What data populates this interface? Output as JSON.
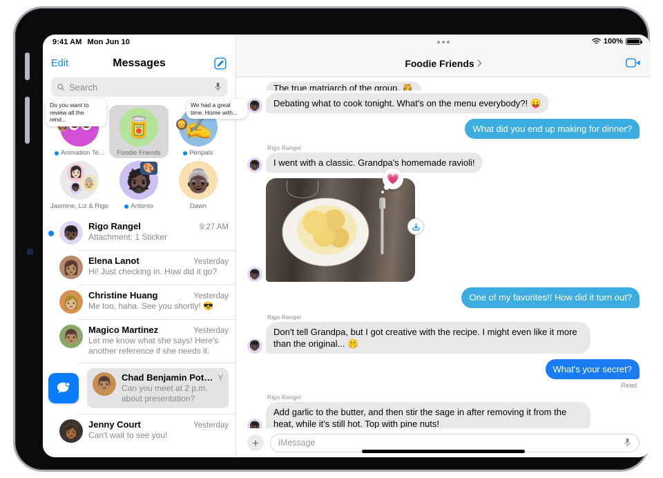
{
  "status_bar": {
    "time": "9:41 AM",
    "date": "Mon Jun 10",
    "battery_percent": "100%",
    "wifi_icon": "wifi-icon",
    "battery_icon": "battery-icon"
  },
  "sidebar": {
    "edit_label": "Edit",
    "title": "Messages",
    "compose_icon": "compose-icon",
    "search": {
      "placeholder": "Search",
      "search_icon": "search-icon",
      "mic_icon": "microphone-icon"
    },
    "pinned": [
      {
        "name": "Animation Te...",
        "full_name": "Animation Team",
        "avatar_emoji": "",
        "avatar_bg": "#d34fd6",
        "unread": true,
        "selected": false,
        "preview_bubble": "Do you want to review all the rend...",
        "mini_emoji": "👩"
      },
      {
        "name": "Foodie Friends",
        "full_name": "Foodie Friends",
        "avatar_emoji": "🥫",
        "avatar_bg": "#b4e39a",
        "unread": false,
        "selected": true,
        "preview_bubble": "",
        "mini_emoji": ""
      },
      {
        "name": "Penpals",
        "full_name": "Penpals",
        "avatar_emoji": "✍️",
        "avatar_bg": "#8fbde4",
        "unread": true,
        "selected": false,
        "preview_bubble": "We had a great time. Home with...",
        "mini_emoji": "👴"
      },
      {
        "name": "Jasmine, Liz & Rigo",
        "full_name": "Jasmine, Liz & Rigo",
        "avatar_emoji": "",
        "avatar_bg": "#e9e9ec",
        "unread": false,
        "selected": false,
        "preview_bubble": "",
        "mini_emoji": ""
      },
      {
        "name": "Antonio",
        "full_name": "Antonio",
        "avatar_emoji": "🧔🏿",
        "avatar_bg": "#cdc0f2",
        "unread": true,
        "selected": false,
        "preview_bubble": "",
        "mini_emoji": "",
        "sticker_emoji": "🎨"
      },
      {
        "name": "Dawn",
        "full_name": "Dawn",
        "avatar_emoji": "👵🏿",
        "avatar_bg": "#fadfb0",
        "unread": false,
        "selected": false,
        "preview_bubble": "",
        "mini_emoji": ""
      }
    ],
    "conversations": [
      {
        "name": "Rigo Rangel",
        "time": "9:27 AM",
        "preview": "Attachment: 1 Sticker",
        "unread": true,
        "avatar_emoji": "👦🏿",
        "avatar_bg": "#e2d8f5",
        "dragging": false
      },
      {
        "name": "Elena Lanot",
        "time": "Yesterday",
        "preview": "Hi! Just checking in. How did it go?",
        "unread": false,
        "avatar_emoji": "👩🏽",
        "avatar_bg": "#c9a58c",
        "dragging": false
      },
      {
        "name": "Christine Huang",
        "time": "Yesterday",
        "preview": "Me too, haha. See you shortly! 😎",
        "unread": false,
        "avatar_emoji": "👩🏼",
        "avatar_bg": "#d8914f",
        "dragging": false
      },
      {
        "name": "Magico Martinez",
        "time": "Yesterday",
        "preview": "Let me know what she says! Here's another reference if she needs it.",
        "unread": false,
        "avatar_emoji": "👨🏽",
        "avatar_bg": "#8aa86b",
        "dragging": false
      },
      {
        "name": "Chad Benjamin Potter",
        "time": "Y",
        "preview": "Can you meet at 2 p.m. about presentation?",
        "unread": false,
        "avatar_emoji": "👨🏽",
        "avatar_bg": "#c98f4e",
        "dragging": true,
        "drag_icon": "message-bubble-icon"
      },
      {
        "name": "Jenny Court",
        "time": "Yesterday",
        "preview": "Can't wait to see you!",
        "unread": false,
        "avatar_emoji": "👩🏾",
        "avatar_bg": "#3b3330",
        "dragging": false
      }
    ]
  },
  "chat": {
    "title": "Foodie Friends",
    "chevron_icon": "chevron-right-icon",
    "facetime_icon": "facetime-video-icon",
    "multitask_icon": "multitasking-dots-icon",
    "clipped_top_message": "The true matriarch of the group. 👸",
    "messages": [
      {
        "id": "m1",
        "type": "text",
        "direction": "in",
        "sender": "",
        "text": "Debating what to cook tonight. What's on the menu everybody?! 😛",
        "show_avatar": true,
        "show_sender": false,
        "bubble_color": "#e8e8ea"
      },
      {
        "id": "m2",
        "type": "text",
        "direction": "out",
        "sender": "",
        "text": "What did you end up making for dinner?",
        "show_avatar": false,
        "show_sender": false,
        "bubble_color": "#3cade0"
      },
      {
        "id": "m3",
        "type": "text",
        "direction": "in",
        "sender": "Rigo Rangel",
        "text": "I went with a classic. Grandpa's homemade ravioli!",
        "show_avatar": true,
        "show_sender": true,
        "bubble_color": "#e8e8ea"
      },
      {
        "id": "m4",
        "type": "photo",
        "direction": "in",
        "sender": "",
        "text": "",
        "alt": "Plate of ravioli with sage on a wooden table",
        "reaction_emoji": "💗",
        "save_icon": "save-to-photos-icon",
        "show_avatar": true,
        "show_sender": false
      },
      {
        "id": "m5",
        "type": "text",
        "direction": "out",
        "sender": "",
        "text": "One of my favorites!! How did it turn out?",
        "show_avatar": false,
        "show_sender": false,
        "bubble_color": "#3cade0"
      },
      {
        "id": "m6",
        "type": "text",
        "direction": "in",
        "sender": "Rigo Rangel",
        "text": "Don't tell Grandpa, but I got creative with the recipe. I might even like it more than the original... 🤫",
        "show_avatar": true,
        "show_sender": true,
        "bubble_color": "#e8e8ea"
      },
      {
        "id": "m7",
        "type": "text",
        "direction": "out",
        "sender": "",
        "text": "What's your secret?",
        "show_avatar": false,
        "show_sender": false,
        "bubble_color": "#1a7cf5",
        "receipt": "Read"
      },
      {
        "id": "m8",
        "type": "text",
        "direction": "in",
        "sender": "Rigo Rangel",
        "text": "Add garlic to the butter, and then stir the sage in after removing it from the heat, while it's still hot. Top with pine nuts!",
        "show_avatar": true,
        "show_sender": true,
        "bubble_color": "#e8e8ea"
      }
    ],
    "composer": {
      "plus_icon": "plus-attachment-icon",
      "placeholder": "iMessage",
      "mic_icon": "microphone-icon"
    }
  },
  "colors": {
    "accent_blue": "#0a84ff",
    "bubble_in": "#e8e8ea",
    "bubble_out_light": "#3cade0",
    "bubble_out_strong": "#1a7cf5",
    "sidebar_bg": "#ffffff",
    "nav_bg": "#f6f6f6"
  }
}
